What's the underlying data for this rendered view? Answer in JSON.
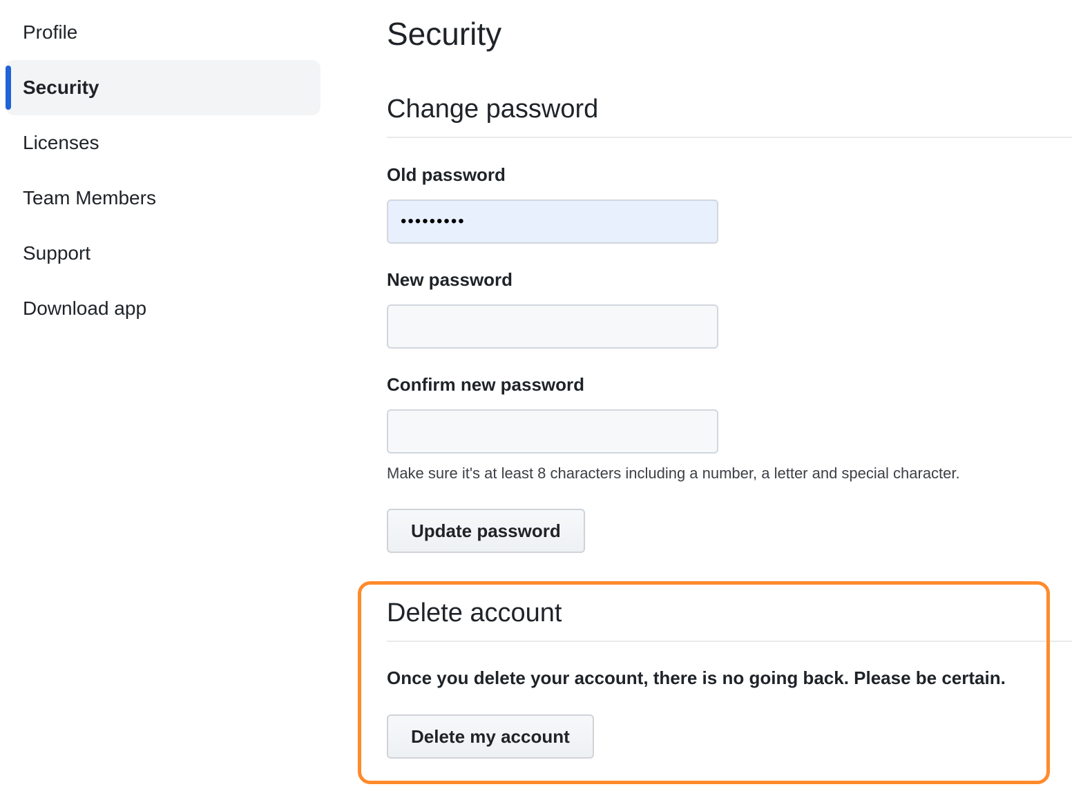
{
  "sidebar": {
    "items": [
      {
        "label": "Profile",
        "active": false
      },
      {
        "label": "Security",
        "active": true
      },
      {
        "label": "Licenses",
        "active": false
      },
      {
        "label": "Team Members",
        "active": false
      },
      {
        "label": "Support",
        "active": false
      },
      {
        "label": "Download app",
        "active": false
      }
    ]
  },
  "main": {
    "title": "Security",
    "change_password": {
      "heading": "Change password",
      "old_password": {
        "label": "Old password",
        "value": "•••••••••"
      },
      "new_password": {
        "label": "New password",
        "value": ""
      },
      "confirm_password": {
        "label": "Confirm new password",
        "value": ""
      },
      "hint": "Make sure it's at least 8 characters including a number, a letter and special character.",
      "submit_label": "Update password"
    },
    "delete_account": {
      "heading": "Delete account",
      "warning": "Once you delete your account, there is no going back. Please be certain.",
      "button_label": "Delete my account"
    }
  },
  "colors": {
    "accent": "#1f63d6",
    "highlight": "#ff8a2b",
    "autofill_bg": "#e8f0fe"
  }
}
